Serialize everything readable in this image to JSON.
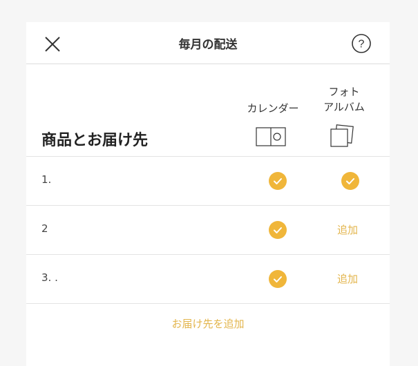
{
  "header": {
    "title": "毎月の配送",
    "close_icon": "close-icon",
    "help_icon": "help-icon"
  },
  "columns": {
    "calendar": {
      "label": "カレンダー",
      "icon": "calendar-icon"
    },
    "photo_album": {
      "label": "フォト\nアルバム",
      "icon": "photo-album-icon"
    }
  },
  "section_title": "商品とお届け先",
  "rows": [
    {
      "label": "1.",
      "calendar": "checked",
      "photo_album": "checked",
      "photo_album_add": ""
    },
    {
      "label": "2",
      "calendar": "checked",
      "photo_album": "add",
      "photo_album_add": "追加"
    },
    {
      "label": "3. .",
      "calendar": "checked",
      "photo_album": "add",
      "photo_album_add": "追加"
    }
  ],
  "add_recipient_label": "お届け先を追加",
  "colors": {
    "accent": "#f0b63a",
    "accent_text": "#e3b54c",
    "divider": "#dcdcdc"
  }
}
